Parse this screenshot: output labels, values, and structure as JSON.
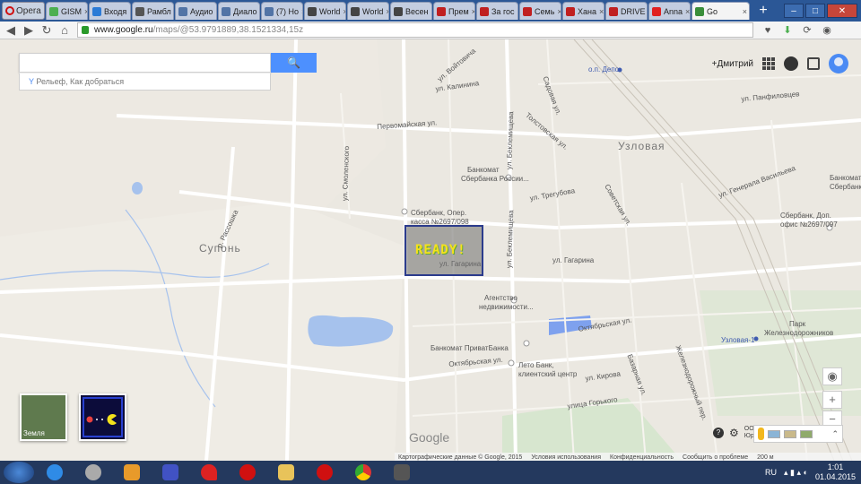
{
  "browser": {
    "tabs": [
      {
        "label": "Opera",
        "color": "#d01010"
      },
      {
        "label": "GISM",
        "color": "#4caf50"
      },
      {
        "label": "Входя",
        "color": "#2b7bd6"
      },
      {
        "label": "Рамбл",
        "color": "#555555"
      },
      {
        "label": "Аудио",
        "color": "#5274a6"
      },
      {
        "label": "Диало",
        "color": "#5274a6"
      },
      {
        "label": "(7) Но",
        "color": "#5274a6"
      },
      {
        "label": "World",
        "color": "#444444"
      },
      {
        "label": "World",
        "color": "#444444"
      },
      {
        "label": "Весен",
        "color": "#444444"
      },
      {
        "label": "Прем",
        "color": "#c02020"
      },
      {
        "label": "За гос",
        "color": "#c02020"
      },
      {
        "label": "Семь",
        "color": "#c02020"
      },
      {
        "label": "Хана",
        "color": "#c02020"
      },
      {
        "label": "DRIVE",
        "color": "#c02020"
      },
      {
        "label": "Anna",
        "color": "#e02020"
      },
      {
        "label": "Go",
        "color": "#3a8e3a"
      }
    ],
    "url_host": "www.google.ru",
    "url_path": "/maps/@53.9791889,38.1521334,15z"
  },
  "map": {
    "search": {
      "value": "",
      "button_icon": "search-icon",
      "sub": "Рельеф, Как добраться"
    },
    "user": "+Дмитрий",
    "labels": [
      {
        "text": "Узловая",
        "kind": "big",
        "pos": "uzl"
      },
      {
        "text": "Супонь",
        "kind": "big",
        "pos": "sup"
      },
      {
        "text": "о.п. Депо",
        "kind": "blue",
        "pos": "depo"
      },
      {
        "text": "ул. Калинина",
        "pos": "kal"
      },
      {
        "text": "Первомайская ул.",
        "pos": "perv"
      },
      {
        "text": "ул. Панфиловцев",
        "pos": "panf"
      },
      {
        "text": "Толстовская ул.",
        "pos": "tol"
      },
      {
        "text": "Банкомат",
        "pos": "b1"
      },
      {
        "text": "Сбербанка России...",
        "pos": "b2"
      },
      {
        "text": "Сбербанк, Опер.",
        "pos": "s1"
      },
      {
        "text": "касса №2697/098",
        "pos": "s2"
      },
      {
        "text": "ул. Гагарина",
        "pos": "gag"
      },
      {
        "text": "ул. Гагарина",
        "pos": "gag2"
      },
      {
        "text": "Агентство",
        "pos": "ag1"
      },
      {
        "text": "недвижимости...",
        "pos": "ag2"
      },
      {
        "text": "Банкомат ПриватБанка",
        "pos": "priv"
      },
      {
        "text": "Лето Банк,",
        "pos": "leto1"
      },
      {
        "text": "клиентский центр",
        "pos": "leto2"
      },
      {
        "text": "Октябрьская ул.",
        "pos": "okt"
      },
      {
        "text": "Октябрьская ул.",
        "pos": "okt2"
      },
      {
        "text": "ул. Кирова",
        "pos": "kir"
      },
      {
        "text": "улица Горького",
        "pos": "gor"
      },
      {
        "text": "Сбербанк, Доп.",
        "pos": "sd1"
      },
      {
        "text": "офис №2697/097",
        "pos": "sd2"
      },
      {
        "text": "Банкомат",
        "pos": "bk3"
      },
      {
        "text": "Сбербанка",
        "pos": "bk4"
      },
      {
        "text": "ул. Генерала Васильева",
        "pos": "vas"
      },
      {
        "text": "Парк",
        "pos": "park1"
      },
      {
        "text": "Железнодорожников",
        "pos": "park2"
      },
      {
        "text": "Узловая-1",
        "kind": "blue",
        "pos": "uz1"
      },
      {
        "text": "р. Рассошка",
        "pos": "ras"
      },
      {
        "text": "ул. Беклемищева",
        "pos": "bek"
      },
      {
        "text": "ул. Беклемищева",
        "pos": "bek2"
      },
      {
        "text": "ул. Трегубова",
        "pos": "treg"
      },
      {
        "text": "ул. Смоленского",
        "pos": "smol"
      },
      {
        "text": "ул. Войтовича",
        "pos": "voyt"
      },
      {
        "text": "Садовая ул.",
        "pos": "sad"
      },
      {
        "text": "Советская ул.",
        "pos": "sov"
      },
      {
        "text": "Базарная ул.",
        "pos": "baz"
      },
      {
        "text": "Железнодорожный пер.",
        "pos": "zhd"
      }
    ],
    "ready_text": "READY!",
    "earth_label": "Земля",
    "google_logo": "Google",
    "footer": [
      "Картографические данные © Google, 2015",
      "Условия использования",
      "Конфиденциальность",
      "Сообщить о проблеме",
      "200 м"
    ],
    "zoom_in": "+",
    "zoom_out": "−",
    "company": "ООО",
    "company2": "Юридич"
  },
  "taskbar": {
    "lang": "RU",
    "time": "1:01",
    "date": "01.04.2015"
  }
}
